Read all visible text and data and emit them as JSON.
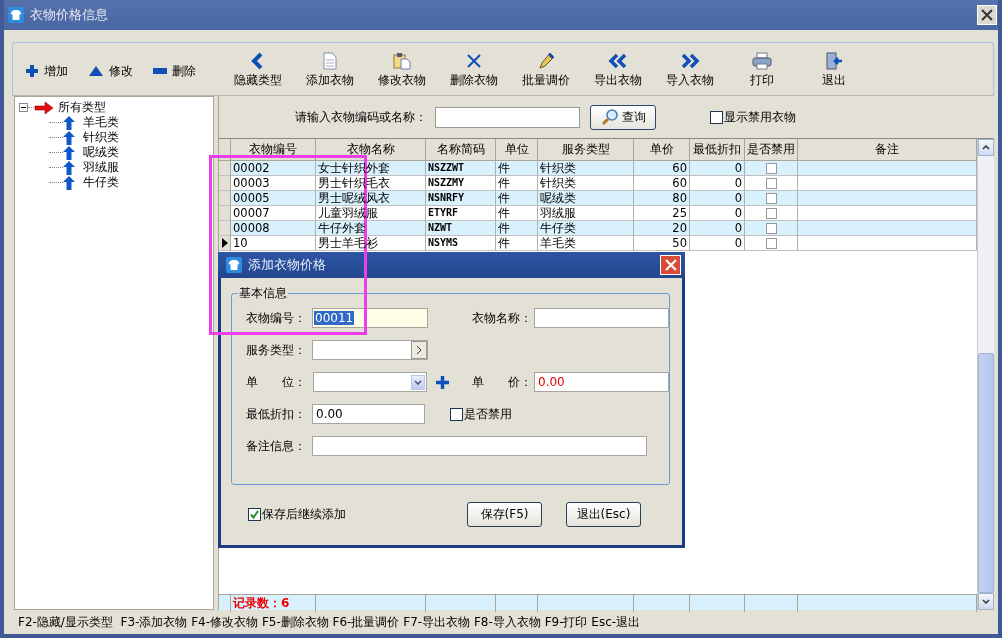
{
  "window": {
    "title": "衣物价格信息"
  },
  "toolbar": {
    "small_buttons": [
      "增加",
      "修改",
      "删除"
    ],
    "buttons": [
      "隐藏类型",
      "添加衣物",
      "修改衣物",
      "删除衣物",
      "批量调价",
      "导出衣物",
      "导入衣物",
      "打印",
      "退出"
    ]
  },
  "tree": {
    "label": "所有类型",
    "expanded": true,
    "children": [
      {
        "label": "羊毛类"
      },
      {
        "label": "针织类"
      },
      {
        "label": "呢绒类"
      },
      {
        "label": "羽绒服"
      },
      {
        "label": "牛仔类"
      }
    ]
  },
  "search": {
    "label": "请输入衣物编码或名称：",
    "button": "查询",
    "show_disabled": {
      "label": "显示禁用衣物",
      "checked": false
    }
  },
  "table": {
    "columns": [
      {
        "label": "衣物编号",
        "kind": "text"
      },
      {
        "label": "衣物名称",
        "kind": "text"
      },
      {
        "label": "名称简码",
        "kind": "code"
      },
      {
        "label": "单位",
        "kind": "text"
      },
      {
        "label": "服务类型",
        "kind": "text"
      },
      {
        "label": "单价",
        "kind": "number"
      },
      {
        "label": "最低折扣",
        "kind": "number"
      },
      {
        "label": "是否禁用",
        "kind": "check"
      },
      {
        "label": "备注",
        "kind": "text"
      }
    ],
    "rows": [
      {
        "cells": [
          "00002",
          "女士针织外套",
          "NSZZWT",
          "件",
          "针织类",
          "60",
          "0"
        ],
        "disabled": false,
        "selected": false
      },
      {
        "cells": [
          "00003",
          "男士针织毛衣",
          "NSZZMY",
          "件",
          "针织类",
          "60",
          "0"
        ],
        "disabled": false,
        "selected": false
      },
      {
        "cells": [
          "00005",
          "男士呢绒风衣",
          "NSNRFY",
          "件",
          "呢绒类",
          "80",
          "0"
        ],
        "disabled": false,
        "selected": false
      },
      {
        "cells": [
          "00007",
          "儿童羽绒服",
          "ETYRF",
          "件",
          "羽绒服",
          "25",
          "0"
        ],
        "disabled": false,
        "selected": false
      },
      {
        "cells": [
          "00008",
          "牛仔外套",
          "NZWT",
          "件",
          "牛仔类",
          "20",
          "0"
        ],
        "disabled": false,
        "selected": false
      },
      {
        "cells": [
          "10",
          "男士羊毛衫",
          "NSYMS",
          "件",
          "羊毛类",
          "50",
          "0"
        ],
        "disabled": false,
        "selected": true
      }
    ],
    "footer": "记录数：6"
  },
  "status_bar": "F2-隐藏/显示类型  F3-添加衣物 F4-修改衣物 F5-删除衣物 F6-批量调价 F7-导出衣物 F8-导入衣物 F9-打印 Esc-退出",
  "dialog": {
    "title": "添加衣物价格",
    "group": "基本信息",
    "code": {
      "label": "衣物编号：",
      "value": "00011"
    },
    "name": {
      "label": "衣物名称："
    },
    "service_type": {
      "label": "服务类型："
    },
    "unit": {
      "label": "单　　位："
    },
    "price": {
      "label": "单　　价：",
      "value": "0.00"
    },
    "min_discount": {
      "label": "最低折扣：",
      "value": "0.00"
    },
    "disabled": {
      "label": "是否禁用",
      "checked": false
    },
    "remark": {
      "label": "备注信息："
    },
    "keep_adding": {
      "label": "保存后继续添加",
      "checked": true
    },
    "buttons": [
      "保存(F5)",
      "退出(Esc)"
    ]
  }
}
